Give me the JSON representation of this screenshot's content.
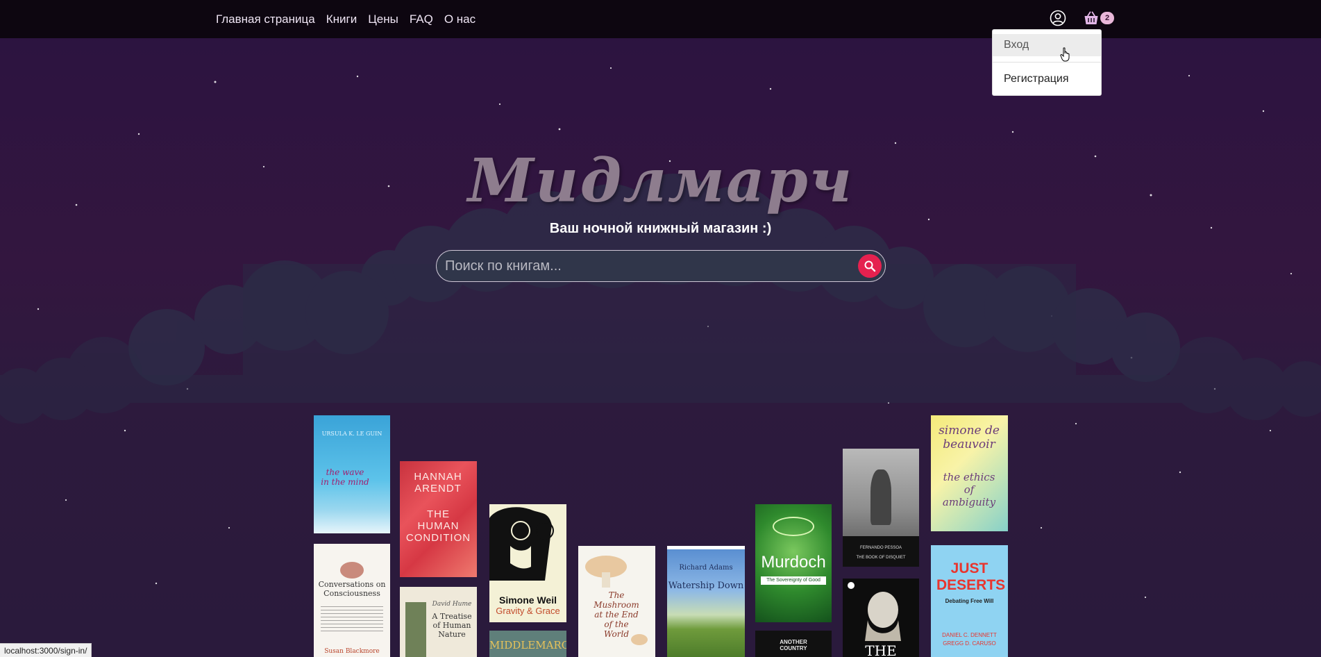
{
  "nav": {
    "links": [
      "Главная страница",
      "Книги",
      "Цены",
      "FAQ",
      "О нас"
    ],
    "cart_count": "2",
    "icons": [
      "user-icon",
      "basket-icon"
    ]
  },
  "dropdown": {
    "items": [
      "Вход",
      "Регистрация"
    ]
  },
  "hero": {
    "title": "Мидлмарч",
    "subtitle": "Ваш ночной книжный магазин :)"
  },
  "search": {
    "placeholder": "Поиск по книгам...",
    "icon": "search-icon"
  },
  "status_bar": {
    "url": "localhost:3000/sign-in/"
  },
  "books": [
    {
      "lines": [
        "URSULA K. LE GUIN",
        "the wave in the mind"
      ]
    },
    {
      "lines": [
        "Conversations on Consciousness",
        "Susan Blackmore"
      ]
    },
    {
      "lines": [
        "HANNAH ARENDT",
        "THE HUMAN CONDITION"
      ]
    },
    {
      "lines": [
        "David Hume",
        "A Treatise of Human Nature"
      ]
    },
    {
      "lines": [
        "Simone Weil",
        "Gravity & Grace"
      ]
    },
    {
      "lines": [
        "MIDDLEMARCH"
      ]
    },
    {
      "lines": [
        "The Mushroom at the End of the World"
      ]
    },
    {
      "lines": [
        "Richard Adams",
        "Watership Down"
      ]
    },
    {
      "lines": [
        "Murdoch",
        "The Sovereignty of Good"
      ]
    },
    {
      "lines": [
        "ANOTHER COUNTRY"
      ]
    },
    {
      "lines": [
        "FERNANDO PESSOA",
        "THE BOOK OF DISQUIET"
      ]
    },
    {
      "lines": [
        "THE REPUBLIC"
      ]
    },
    {
      "lines": [
        "simone de beauvoir",
        "the ethics of ambiguity"
      ]
    },
    {
      "lines": [
        "JUST DESERTS",
        "Debating Free Will",
        "DANIEL C. DENNETT",
        "GREGG D. CARUSO"
      ]
    }
  ],
  "colors": {
    "navbar": "#0d0610",
    "background": "#2b1340",
    "search_button": "#e5214f",
    "badge": "#e9b7d9"
  }
}
